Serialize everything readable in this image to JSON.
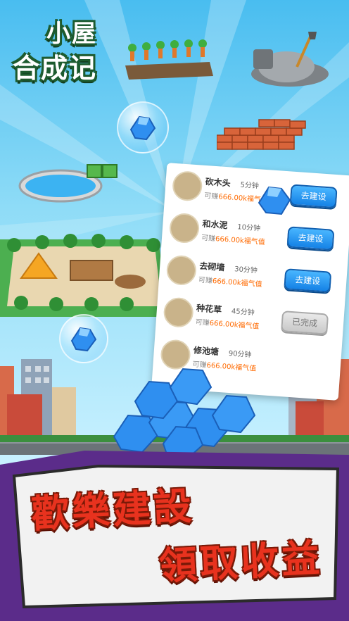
{
  "title": {
    "line1": "小屋",
    "line2": "合成记"
  },
  "tasks": [
    {
      "name": "砍木头",
      "time": "5分钟",
      "earn_prefix": "可赚",
      "earn_amount": "666.00k",
      "earn_suffix": "福气值",
      "button": "去建设",
      "status": "active"
    },
    {
      "name": "和水泥",
      "time": "10分钟",
      "earn_prefix": "可赚",
      "earn_amount": "666.00k",
      "earn_suffix": "福气值",
      "button": "去建设",
      "status": "active"
    },
    {
      "name": "去砌墙",
      "time": "30分钟",
      "earn_prefix": "可赚",
      "earn_amount": "666.00k",
      "earn_suffix": "福气值",
      "button": "去建设",
      "status": "active"
    },
    {
      "name": "种花草",
      "time": "45分钟",
      "earn_prefix": "可赚",
      "earn_amount": "666.00k",
      "earn_suffix": "福气值",
      "button": "已完成",
      "status": "done"
    },
    {
      "name": "修池塘",
      "time": "90分钟",
      "earn_prefix": "可赚",
      "earn_amount": "666.00k",
      "earn_suffix": "福气值",
      "button": "",
      "status": "none"
    }
  ],
  "banner": {
    "line1": "歡樂建設",
    "line2": "領取收益"
  },
  "colors": {
    "sky": "#49bdf0",
    "button_blue": "#1582e6",
    "earn_orange": "#ff6a00",
    "headline_red": "#e8321e",
    "banner_purple": "#5b2c8a"
  }
}
